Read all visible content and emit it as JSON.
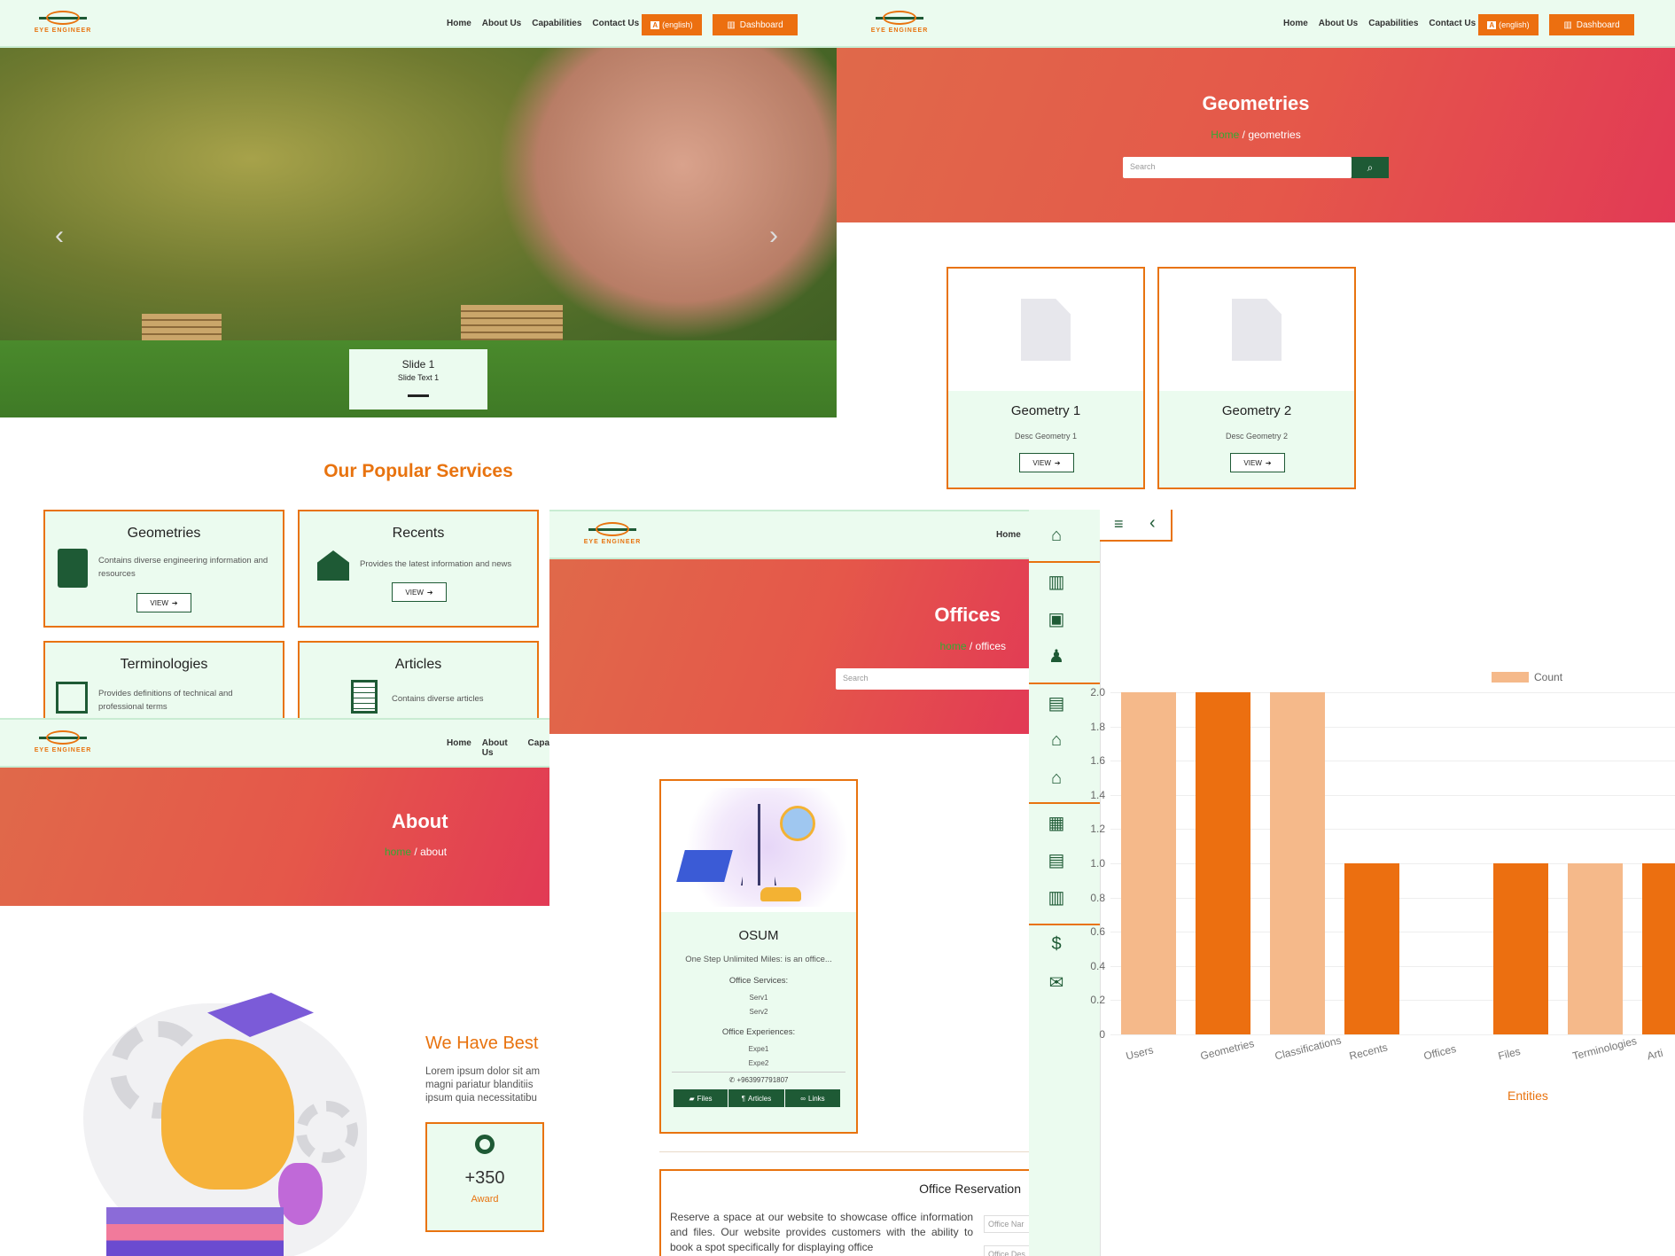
{
  "logo_text": "EYE ENGINEER",
  "nav": {
    "home": "Home",
    "about": "About Us",
    "capabilities": "Capabilities",
    "contact": "Contact Us",
    "lang_badge": "A",
    "lang_label": "(english)",
    "dashboard": "Dashboard",
    "capa_trunc": "Capa"
  },
  "slider": {
    "title": "Slide 1",
    "text": "Slide Text 1"
  },
  "services": {
    "heading": "Our Popular Services",
    "items": [
      {
        "title": "Geometries",
        "desc": "Contains diverse engineering information and resources",
        "view": "VIEW"
      },
      {
        "title": "Recents",
        "desc": "Provides the latest information and news",
        "view": "VIEW"
      },
      {
        "title": "Terminologies",
        "desc": "Provides definitions of technical and professional terms"
      },
      {
        "title": "Articles",
        "desc": "Contains diverse articles"
      }
    ]
  },
  "geometries_page": {
    "title": "Geometries",
    "crumb_home": "Home",
    "crumb_sep": "/",
    "crumb_current": "geometries",
    "search_placeholder": "Search",
    "cards": [
      {
        "title": "Geometry 1",
        "desc": "Desc Geometry 1",
        "view": "VIEW"
      },
      {
        "title": "Geometry 2",
        "desc": "Desc Geometry 2",
        "view": "VIEW"
      }
    ]
  },
  "about_page": {
    "title": "About",
    "crumb_home": "home",
    "crumb_sep": "/",
    "crumb_current": "about",
    "heading": "We Have Best",
    "lorem": "Lorem ipsum dolor sit am magni pariatur blanditiis ipsum quia necessitatibu",
    "stat_value": "+350",
    "stat_label": "Award"
  },
  "offices_page": {
    "nav_home": "Home",
    "title": "Offices",
    "crumb_home": "home",
    "crumb_sep": "/",
    "crumb_current": "offices",
    "search_placeholder": "Search",
    "office": {
      "name": "OSUM",
      "desc": "One Step Unlimited Miles: is an office...",
      "services_label": "Office Services:",
      "services": [
        "Serv1",
        "Serv2"
      ],
      "experiences_label": "Office Experiences:",
      "experiences": [
        "Expe1",
        "Expe2"
      ],
      "phone": "+963997791807",
      "btn_files": "Files",
      "btn_articles": "Articles",
      "btn_links": "Links"
    },
    "reservation": {
      "title": "Office Reservation",
      "text": "Reserve a space at our website to showcase office information and files. Our website provides customers with the ability to book a spot specifically for displaying office",
      "field_name": "Office Nar",
      "field_desc": "Office Des"
    }
  },
  "colors": {
    "accent": "#ec6f10",
    "green": "#1e5a35",
    "mint": "#ebfbef",
    "light_bar": "#f5b98a"
  },
  "chart_data": {
    "type": "bar",
    "legend": "Count",
    "xlabel": "Entities",
    "ylim": [
      0,
      2.0
    ],
    "yticks": [
      "2.0",
      "1.8",
      "1.6",
      "1.4",
      "1.2",
      "1.0",
      "0.8",
      "0.6",
      "0.4",
      "0.2",
      "0"
    ],
    "categories": [
      "Users",
      "Geometries",
      "Classifications",
      "Recents",
      "Offices",
      "Files",
      "Terminologies",
      "Arti"
    ],
    "values": [
      2,
      2,
      2,
      1,
      0,
      1,
      1,
      1
    ]
  }
}
